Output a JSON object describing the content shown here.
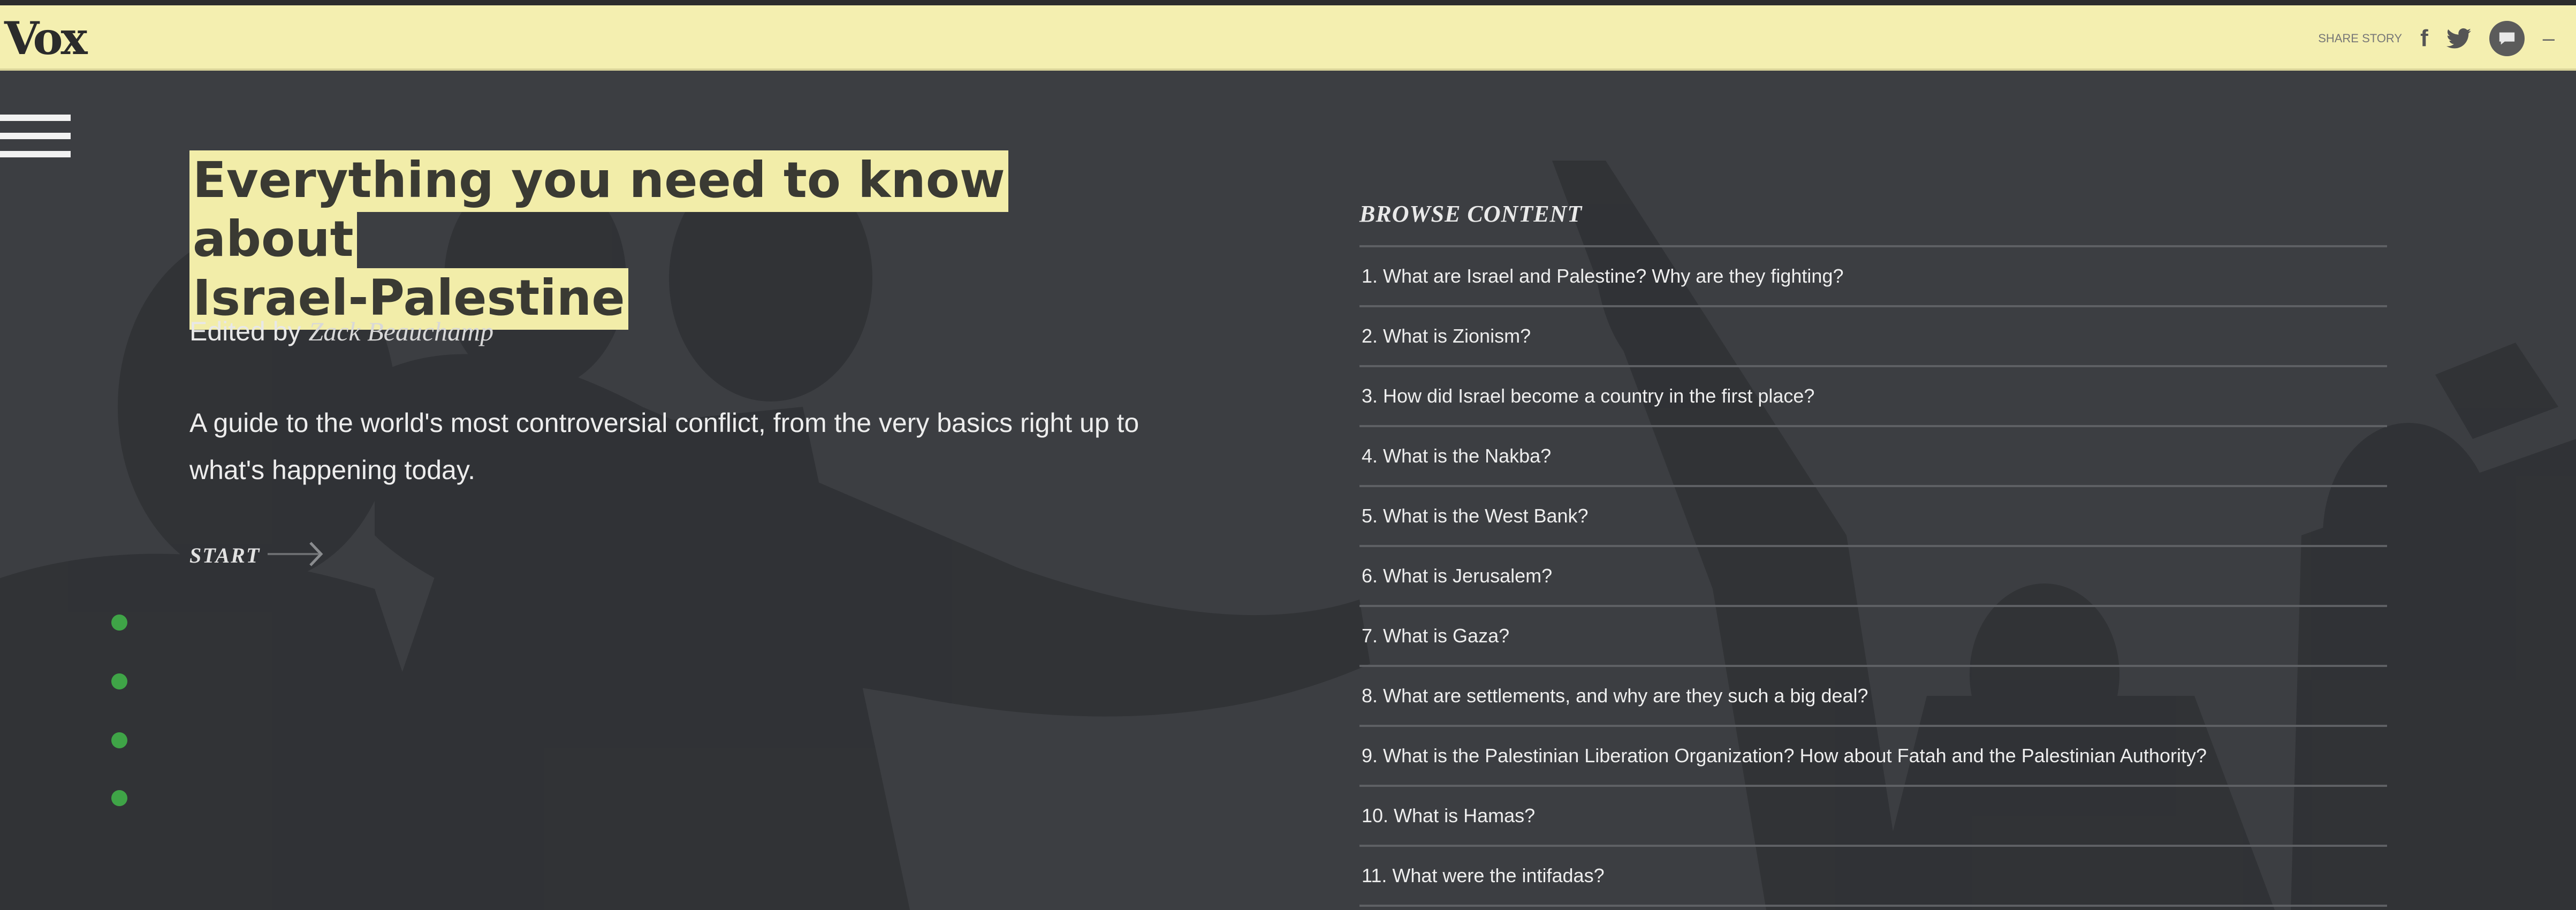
{
  "header": {
    "logo": "Vox",
    "share_label": "SHARE STORY",
    "facebook_glyph": "f",
    "icons": [
      "facebook-icon",
      "twitter-icon",
      "comments-icon",
      "more-icon"
    ]
  },
  "hero": {
    "title_line1": "Everything you need to know about",
    "title_line2": "Israel-Palestine",
    "byline_prefix": "Edited by",
    "byline_author": "Zack Beauchamp",
    "dek": "A guide to the world's most controversial conflict, from the very basics right up to what's happening today.",
    "start_label": "START"
  },
  "section_nav": {
    "dot_count": 4,
    "dot_color": "#3fa447"
  },
  "browse": {
    "heading": "BROWSE CONTENT",
    "items": [
      "1. What are Israel and Palestine? Why are they fighting?",
      "2. What is Zionism?",
      "3. How did Israel become a country in the first place?",
      "4. What is the Nakba?",
      "5. What is the West Bank?",
      "6. What is Jerusalem?",
      "7. What is Gaza?",
      "8. What are settlements, and why are they such a big deal?",
      "9. What is the Palestinian Liberation Organization? How about Fatah and the Palestinian Authority?",
      "10. What is Hamas?",
      "11. What were the intifadas?"
    ]
  },
  "colors": {
    "header_bg": "#f4efb0",
    "title_highlight": "#f2eda9",
    "page_bg": "#3b3d41",
    "divider": "#5e6064"
  }
}
